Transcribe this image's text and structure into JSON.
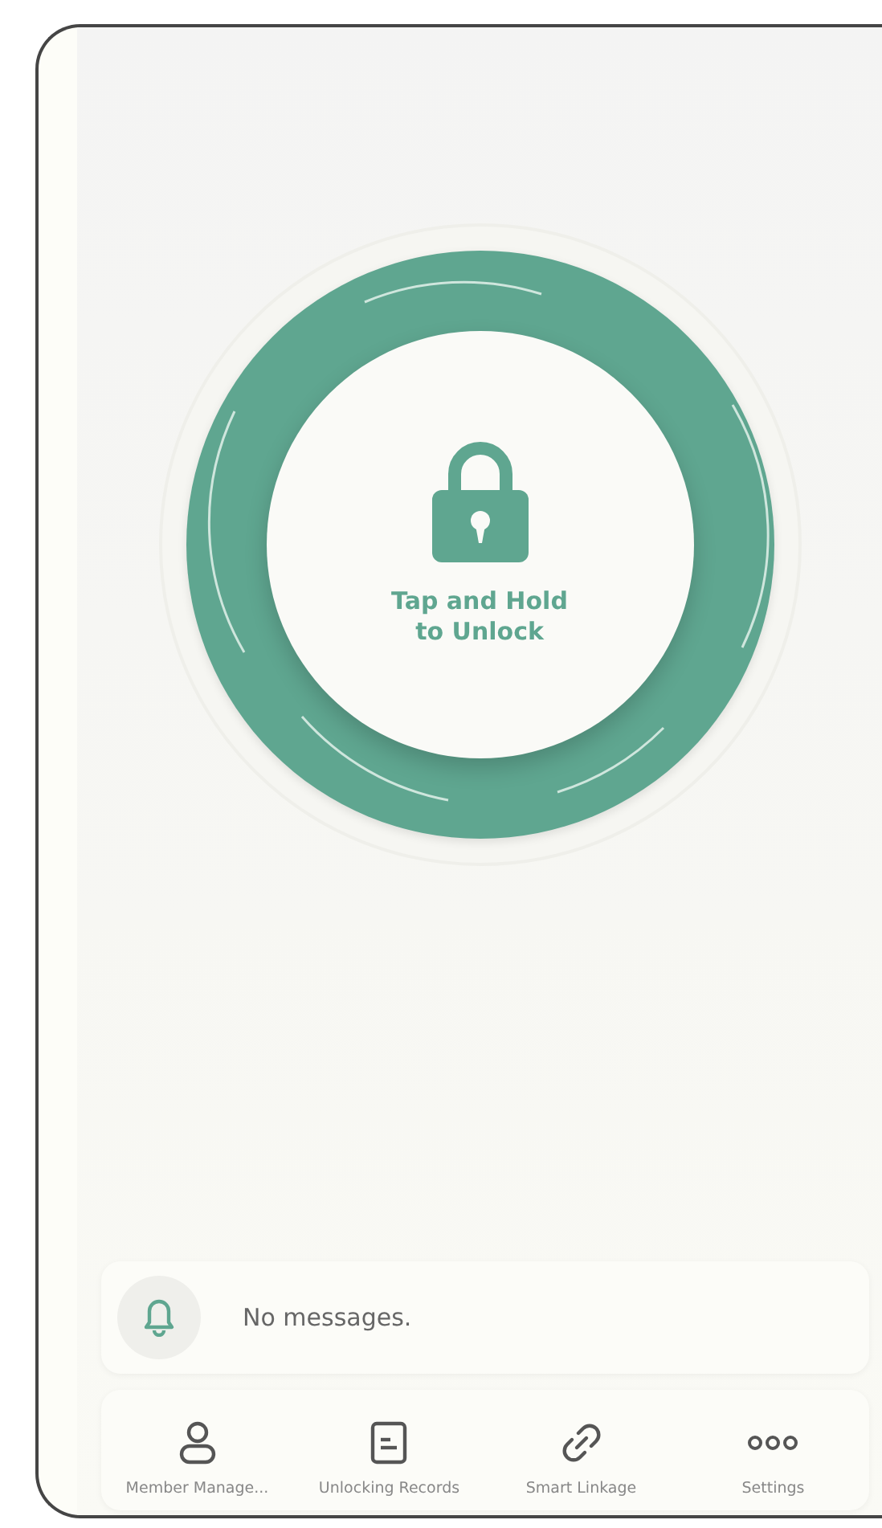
{
  "unlock_button": {
    "label": "Tap and Hold to Unlock"
  },
  "message_bar": {
    "text": "No messages."
  },
  "bottom_nav": [
    {
      "kind": "person",
      "label": "Member Manage..."
    },
    {
      "kind": "document",
      "label": "Unlocking Records"
    },
    {
      "kind": "link",
      "label": "Smart Linkage"
    },
    {
      "kind": "dots",
      "label": "Settings"
    }
  ]
}
